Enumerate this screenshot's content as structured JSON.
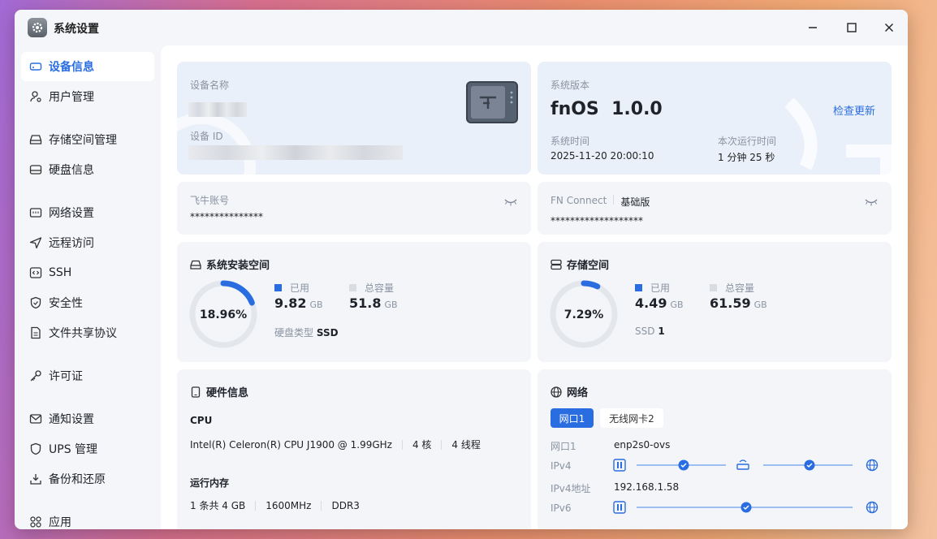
{
  "window": {
    "title": "系统设置"
  },
  "sidebar": {
    "items": [
      {
        "label": "设备信息"
      },
      {
        "label": "用户管理"
      },
      {
        "label": "存储空间管理"
      },
      {
        "label": "硬盘信息"
      },
      {
        "label": "网络设置"
      },
      {
        "label": "远程访问"
      },
      {
        "label": "SSH"
      },
      {
        "label": "安全性"
      },
      {
        "label": "文件共享协议"
      },
      {
        "label": "许可证"
      },
      {
        "label": "通知设置"
      },
      {
        "label": "UPS 管理"
      },
      {
        "label": "备份和还原"
      },
      {
        "label": "应用"
      }
    ]
  },
  "device": {
    "name_label": "设备名称",
    "id_label": "设备 ID"
  },
  "system": {
    "version_label": "系统版本",
    "version_value": "fnOS  1.0.0",
    "check_update": "检查更新",
    "time_label": "系统时间",
    "time_value": "2025-11-20 20:00:10",
    "uptime_label": "本次运行时间",
    "uptime_value": "1 分钟 25 秒"
  },
  "account": {
    "label": "飞牛账号",
    "value": "***************"
  },
  "fnconnect": {
    "label": "FN Connect",
    "tier": "基础版",
    "value": "*******************"
  },
  "sys_space": {
    "title": "系统安装空间",
    "percent_text": "18.96%",
    "percent": 18.96,
    "used_label": "已用",
    "used_value": "9.82",
    "used_unit": "GB",
    "total_label": "总容量",
    "total_value": "51.8",
    "total_unit": "GB",
    "disk_type_label": "硬盘类型",
    "disk_type_value": "SSD"
  },
  "storage": {
    "title": "存储空间",
    "percent_text": "7.29%",
    "percent": 7.29,
    "used_label": "已用",
    "used_value": "4.49",
    "used_unit": "GB",
    "total_label": "总容量",
    "total_value": "61.59",
    "total_unit": "GB",
    "ssd_label": "SSD",
    "ssd_count": "1"
  },
  "hardware": {
    "title": "硬件信息",
    "cpu_label": "CPU",
    "cpu_model": "Intel(R) Celeron(R) CPU J1900 @ 1.99GHz",
    "cpu_cores": "4 核",
    "cpu_threads": "4 线程",
    "ram_label": "运行内存",
    "ram_count": "1 条共 4 GB",
    "ram_speed": "1600MHz",
    "ram_type": "DDR3"
  },
  "network": {
    "title": "网络",
    "tabs": [
      {
        "label": "网口1"
      },
      {
        "label": "无线网卡2"
      }
    ],
    "port_label": "网口1",
    "port_value": "enp2s0-ovs",
    "ipv4_label": "IPv4",
    "ipv4_addr_label": "IPv4地址",
    "ipv4_addr_value": "192.168.1.58",
    "ipv6_label": "IPv6"
  },
  "colors": {
    "accent": "#2a6de0",
    "ring_track": "#e3e6eb"
  }
}
